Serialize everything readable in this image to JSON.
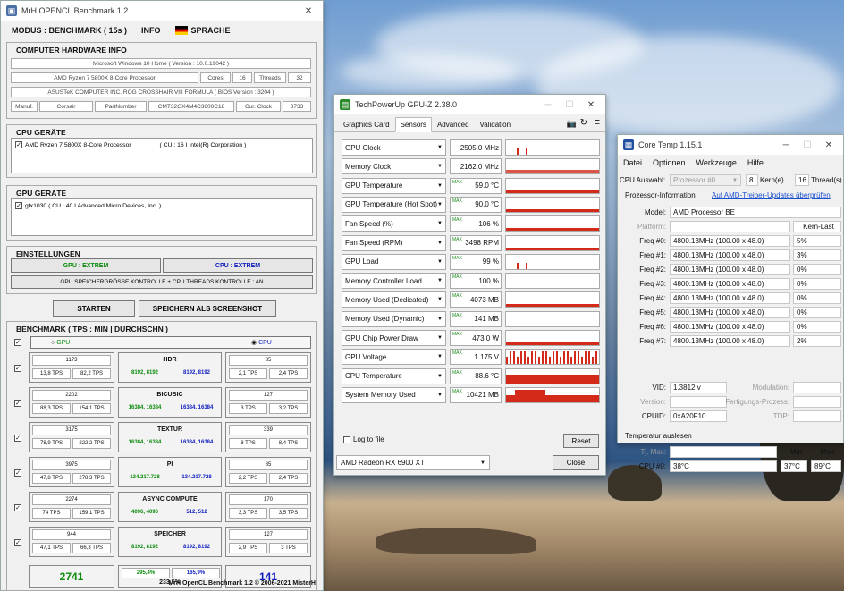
{
  "mrh": {
    "title": "MrH OPENCL Benchmark 1.2",
    "menu": {
      "mode": "MODUS : BENCHMARK ( 15s )",
      "info": "INFO",
      "lang": "SPRACHE"
    },
    "hw_title": "COMPUTER HARDWARE INFO",
    "os": "Microsoft Windows 10 Home ( Version : 10.0.19042 )",
    "cpu": "AMD Ryzen 7 5800X 8-Core Processor",
    "cores_label": "Cores",
    "cores": "16",
    "threads_label": "Threads",
    "threads": "32",
    "board": "ASUSTeK COMPUTER INC. ROG CROSSHAIR VIII FORMULA ( BIOS Version : 3204 )",
    "manuf_label": "Manuf.",
    "manuf": "Corsair",
    "part_label": "PartNumber",
    "part": "CMT32GX4M4C3600C18",
    "clock_label": "Cur. Clock",
    "clock": "3733",
    "cpu_dev_title": "CPU GERÄTE",
    "cpu_dev": "AMD Ryzen 7 5800X 8-Core Processor",
    "cpu_dev_info": "( CU : 16 I Intel(R) Corporation )",
    "gpu_dev_title": "GPU GERÄTE",
    "gpu_dev": "gfx1030 ( CU : 40 I Advanced Micro Devices, Inc. )",
    "settings_title": "EINSTELLUNGEN",
    "gpu_mode": "GPU : EXTREM",
    "cpu_mode": "CPU : EXTREM",
    "settings_line": "GPU SPEICHERGRÖSSE KONTROLLE + CPU THREADS KONTROLLE : AN",
    "start": "STARTEN",
    "save": "SPEICHERN ALS SCREENSHOT",
    "bench_title": "BENCHMARK ( TPS : MIN | DURCHSCHN )",
    "radio_gpu": "GPU",
    "radio_cpu": "CPU",
    "tests": [
      {
        "name": "HDR",
        "gpu_score": "1173",
        "gpu_min": "13,8 TPS",
        "gpu_avg": "82,2 TPS",
        "g1": "8192, 8192",
        "g2": "8192, 8192",
        "cpu_score": "85",
        "cpu_min": "2,1 TPS",
        "cpu_avg": "2,4 TPS"
      },
      {
        "name": "BICUBIC",
        "gpu_score": "2202",
        "gpu_min": "88,3 TPS",
        "gpu_avg": "154,1 TPS",
        "g1": "16384, 16384",
        "g2": "16384, 16384",
        "cpu_score": "127",
        "cpu_min": "3 TPS",
        "cpu_avg": "3,2 TPS"
      },
      {
        "name": "TEXTUR",
        "gpu_score": "3175",
        "gpu_min": "78,9 TPS",
        "gpu_avg": "222,2 TPS",
        "g1": "16384, 16384",
        "g2": "16384, 16384",
        "cpu_score": "339",
        "cpu_min": "8 TPS",
        "cpu_avg": "8,4 TPS"
      },
      {
        "name": "PI",
        "gpu_score": "3975",
        "gpu_min": "47,8 TPS",
        "gpu_avg": "278,3 TPS",
        "g1": "134.217.728",
        "g2": "134.217.728",
        "cpu_score": "85",
        "cpu_min": "2,2 TPS",
        "cpu_avg": "2,4 TPS"
      },
      {
        "name": "ASYNC COMPUTE",
        "gpu_score": "2274",
        "gpu_min": "74 TPS",
        "gpu_avg": "159,1 TPS",
        "g1": "4096, 4096",
        "g2": "512, 512",
        "cpu_score": "170",
        "cpu_min": "3,3 TPS",
        "cpu_avg": "3,5 TPS"
      },
      {
        "name": "SPEICHER",
        "gpu_score": "944",
        "gpu_min": "47,1 TPS",
        "gpu_avg": "66,3 TPS",
        "g1": "8192, 8192",
        "g2": "8192, 8192",
        "cpu_score": "127",
        "cpu_min": "2,9 TPS",
        "cpu_avg": "3 TPS"
      }
    ],
    "total_gpu": "2741",
    "ratio_a": "295,4%",
    "ratio_b": "165,9%",
    "ratio_c": "233,5%",
    "total_cpu": "141",
    "footer": "MrH OpenCL Benchmark 1.2 © 2006-2021 MisterH"
  },
  "gpuz": {
    "title": "TechPowerUp GPU-Z 2.38.0",
    "tabs": [
      "Graphics Card",
      "Sensors",
      "Advanced",
      "Validation"
    ],
    "sensors": [
      {
        "label": "GPU Clock",
        "value": "2505.0 MHz",
        "max": "",
        "graph": "spike"
      },
      {
        "label": "Memory Clock",
        "value": "2162.0 MHz",
        "max": "",
        "graph": "low"
      },
      {
        "label": "GPU Temperature",
        "value": "59.0 °C",
        "max": "MAX",
        "graph": "thin"
      },
      {
        "label": "GPU Temperature (Hot Spot)",
        "value": "90.0 °C",
        "max": "MAX",
        "graph": "thin"
      },
      {
        "label": "Fan Speed (%)",
        "value": "106 %",
        "max": "MAX",
        "graph": "thin"
      },
      {
        "label": "Fan Speed (RPM)",
        "value": "3498 RPM",
        "max": "MAX",
        "graph": "thin"
      },
      {
        "label": "GPU Load",
        "value": "99 %",
        "max": "MAX",
        "graph": "spike"
      },
      {
        "label": "Memory Controller Load",
        "value": "100 %",
        "max": "MAX",
        "graph": "none"
      },
      {
        "label": "Memory Used (Dedicated)",
        "value": "4073 MB",
        "max": "MAX",
        "graph": "thin"
      },
      {
        "label": "Memory Used (Dynamic)",
        "value": "141 MB",
        "max": "MAX",
        "graph": "none"
      },
      {
        "label": "GPU Chip Power Draw",
        "value": "473.0 W",
        "max": "MAX",
        "graph": "thin"
      },
      {
        "label": "GPU Voltage",
        "value": "1.175 V",
        "max": "MAX",
        "graph": "bars"
      },
      {
        "label": "CPU Temperature",
        "value": "88.6 °C",
        "max": "MAX",
        "graph": "half"
      },
      {
        "label": "System Memory Used",
        "value": "10421 MB",
        "max": "MAX",
        "graph": "half2"
      }
    ],
    "log": "Log to file",
    "reset": "Reset",
    "card": "AMD Radeon RX 6900 XT",
    "close": "Close"
  },
  "ct": {
    "title": "Core Temp 1.15.1",
    "menu": [
      "Datei",
      "Optionen",
      "Werkzeuge",
      "Hilfe"
    ],
    "cpu_sel_label": "CPU Auswahl:",
    "cpu_sel": "Prozessor #0",
    "cores": "8",
    "cores_label": "Kern(e)",
    "threads": "16",
    "threads_label": "Thread(s)",
    "proc_info": "Prozessor-Information",
    "link": "Auf AMD-Treiber-Updates überprüfen",
    "model_label": "Model:",
    "model": "AMD Processor  BE",
    "platform_label": "Platform:",
    "kern_last": "Kern-Last",
    "freqs": [
      {
        "label": "Freq #0:",
        "val": "4800.13MHz (100.00 x 48.0)",
        "load": "5%"
      },
      {
        "label": "Freq #1:",
        "val": "4800.13MHz (100.00 x 48.0)",
        "load": "3%"
      },
      {
        "label": "Freq #2:",
        "val": "4800.13MHz (100.00 x 48.0)",
        "load": "0%"
      },
      {
        "label": "Freq #3:",
        "val": "4800.13MHz (100.00 x 48.0)",
        "load": "0%"
      },
      {
        "label": "Freq #4:",
        "val": "4800.13MHz (100.00 x 48.0)",
        "load": "0%"
      },
      {
        "label": "Freq #5:",
        "val": "4800.13MHz (100.00 x 48.0)",
        "load": "0%"
      },
      {
        "label": "Freq #6:",
        "val": "4800.13MHz (100.00 x 48.0)",
        "load": "0%"
      },
      {
        "label": "Freq #7:",
        "val": "4800.13MHz (100.00 x 48.0)",
        "load": "2%"
      }
    ],
    "vid_label": "VID:",
    "vid": "1.3812 v",
    "modulation": "Modulation:",
    "version": "Version:",
    "fert": "Fertigungs-Prozess:",
    "cpuid_label": "CPUID:",
    "cpuid": "0xA20F10",
    "tdp": "TDP:",
    "temp_title": "Temperatur auslesen",
    "tjmax": "Tj. Max:",
    "min": "Min.",
    "max": "Max.",
    "cpu0": "CPU #0:",
    "cur": "38°C",
    "tmin": "37°C",
    "tmax": "89°C"
  }
}
